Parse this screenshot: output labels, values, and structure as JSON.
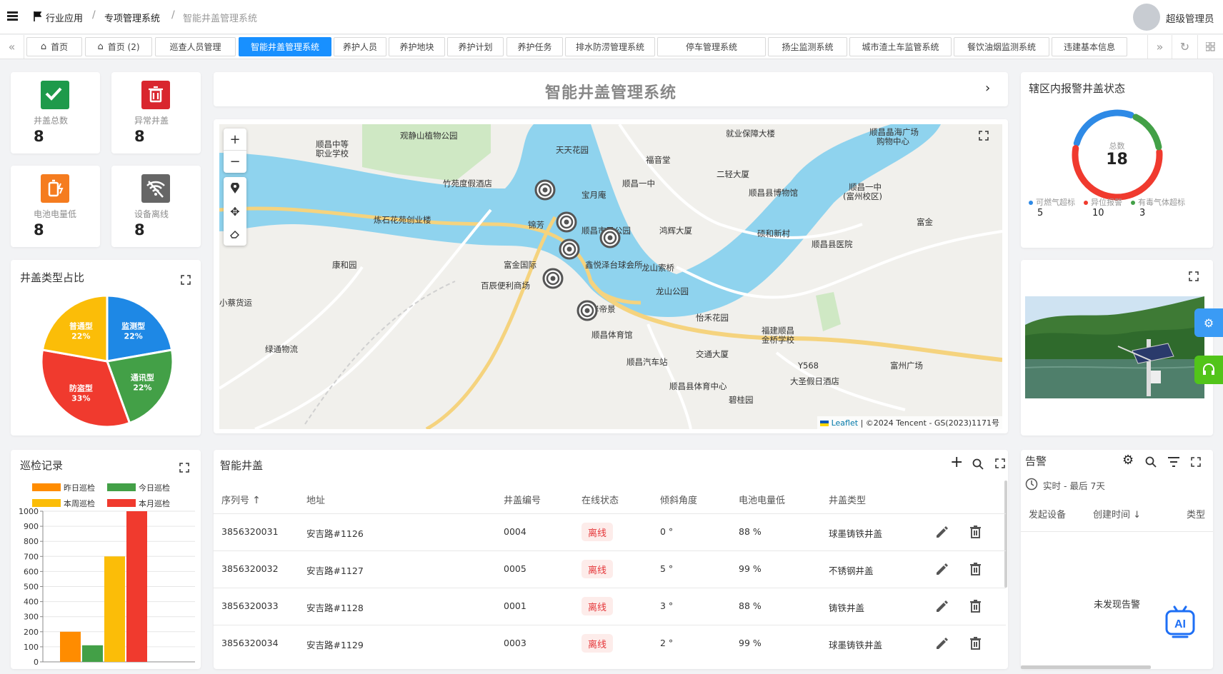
{
  "header": {
    "menu_icon": "hamburger-icon",
    "crumbs": [
      "行业应用",
      "专项管理系统",
      "智能井盖管理系统"
    ],
    "user": "超级管理员"
  },
  "tabs": [
    {
      "label": "首页",
      "icon": "home-icon"
    },
    {
      "label": "首页 (2)",
      "icon": "home-icon"
    },
    {
      "label": "巡查人员管理"
    },
    {
      "label": "智能井盖管理系统",
      "active": true
    },
    {
      "label": "养护人员"
    },
    {
      "label": "养护地块"
    },
    {
      "label": "养护计划"
    },
    {
      "label": "养护任务"
    },
    {
      "label": "排水防涝管理系统"
    },
    {
      "label": "停车管理系统"
    },
    {
      "label": "扬尘监测系统"
    },
    {
      "label": "城市渣土车监管系统"
    },
    {
      "label": "餐饮油烟监测系统"
    },
    {
      "label": "违建基本信息"
    }
  ],
  "stats": [
    {
      "label": "井盖总数",
      "value": "8",
      "color": "#1e9a4b",
      "icon": "check-icon"
    },
    {
      "label": "异常井盖",
      "value": "8",
      "color": "#d9262e",
      "icon": "trash-icon"
    },
    {
      "label": "电池电量低",
      "value": "8",
      "color": "#f57c1f",
      "icon": "battery-icon"
    },
    {
      "label": "设备离线",
      "value": "8",
      "color": "#666666",
      "icon": "wifi-off-icon"
    }
  ],
  "page_title": "智能井盖管理系统",
  "pie": {
    "title": "井盖类型占比",
    "chart_data": {
      "type": "pie",
      "slices": [
        {
          "name": "监测型",
          "pct": "22%",
          "value": 22,
          "color": "#1e88e5"
        },
        {
          "name": "通讯型",
          "pct": "22%",
          "value": 22,
          "color": "#43a047"
        },
        {
          "name": "防盗型",
          "pct": "33%",
          "value": 33,
          "color": "#f03a2e"
        },
        {
          "name": "普通型",
          "pct": "22%",
          "value": 22,
          "color": "#fbbd08"
        }
      ]
    }
  },
  "patrol": {
    "title": "巡检记录",
    "chart_data": {
      "type": "bar",
      "categories": [
        "昨日巡检",
        "今日巡检",
        "本周巡检",
        "本月巡检"
      ],
      "values": [
        200,
        110,
        700,
        1000
      ],
      "colors": [
        "#ff8c00",
        "#43a047",
        "#fbbd08",
        "#f03a2e"
      ],
      "ylim": [
        0,
        1000
      ],
      "yticks": [
        "0",
        "100",
        "200",
        "300",
        "400",
        "500",
        "600",
        "700",
        "800",
        "900",
        "1000"
      ]
    }
  },
  "donut": {
    "title": "辖区内报警井盖状态",
    "center_label": "总数",
    "total": "18",
    "chart_data": {
      "type": "pie",
      "slices": [
        {
          "name": "可燃气超标",
          "value": 5,
          "color": "#2e8ae6"
        },
        {
          "name": "异位报警",
          "value": 10,
          "color": "#f03a2e"
        },
        {
          "name": "有毒气体超标",
          "value": 3,
          "color": "#43a047"
        }
      ]
    }
  },
  "map": {
    "attribution_leaflet": "Leaflet",
    "attribution_rest": "| ©2024 Tencent - GS(2023)1171号",
    "labels": [
      "观静山植物公园",
      "顺昌中等",
      "职业学校",
      "竹苑度假酒店",
      "天天花园",
      "福音堂",
      "就业保障大楼",
      "顺昌晶海广场",
      "购物中心",
      "二轻大厦",
      "顺昌一中",
      "顺昌一中",
      "(富州校区)",
      "宝月庵",
      "顺昌县博物馆",
      "炼石花苑创业楼",
      "锦芳",
      "顺昌市民公园",
      "鸿辉大厦",
      "富金",
      "硕和新村",
      "顺昌县医院",
      "康和园",
      "富金国际",
      "鑫悦泽台球会所",
      "龙山索桥",
      "百辰便利商场",
      "龙山公园",
      "小蔡货运",
      "岸帝景",
      "怡禾花园",
      "顺昌体育馆",
      "福建顺昌",
      "金桥学校",
      "绿通物流",
      "交通大厦",
      "顺昌汽车站",
      "Y568",
      "富州广场",
      "大圣假日酒店",
      "顺昌县体育中心",
      "碧桂园"
    ]
  },
  "table": {
    "title": "智能井盖",
    "columns": [
      "序列号",
      "地址",
      "井盖编号",
      "在线状态",
      "倾斜角度",
      "电池电量低",
      "井盖类型"
    ],
    "rows": [
      {
        "sn": "3856320031",
        "addr": "安吉路#1126",
        "no": "0004",
        "status": "离线",
        "tilt": "0 °",
        "battery": "88 %",
        "type": "球墨铸铁井盖"
      },
      {
        "sn": "3856320032",
        "addr": "安吉路#1127",
        "no": "0005",
        "status": "离线",
        "tilt": "5 °",
        "battery": "99 %",
        "type": "不锈钢井盖"
      },
      {
        "sn": "3856320033",
        "addr": "安吉路#1128",
        "no": "0001",
        "status": "离线",
        "tilt": "3 °",
        "battery": "88 %",
        "type": "铸铁井盖"
      },
      {
        "sn": "3856320034",
        "addr": "安吉路#1129",
        "no": "0003",
        "status": "离线",
        "tilt": "2 °",
        "battery": "99 %",
        "type": "球墨铸铁井盖"
      }
    ]
  },
  "alarms": {
    "title": "告警",
    "range": "实时 - 最后 7天",
    "columns": [
      "发起设备",
      "创建时间",
      "类型"
    ],
    "empty": "未发现告警"
  },
  "ai_label": "AI"
}
